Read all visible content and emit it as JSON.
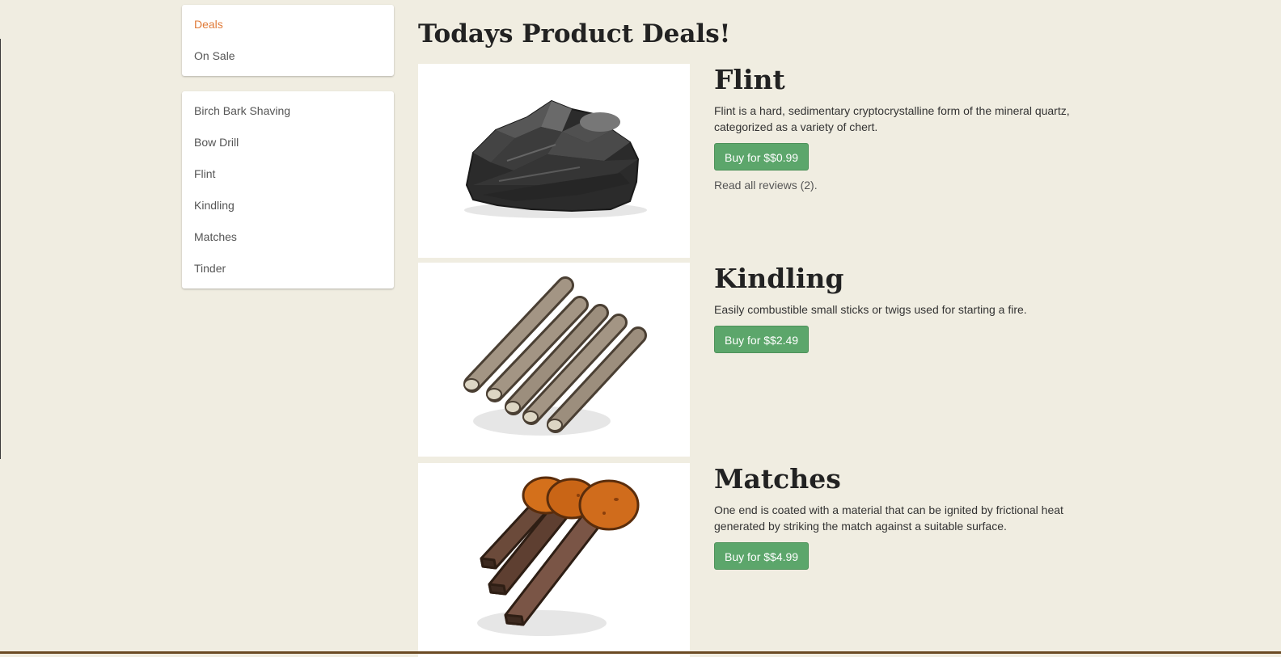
{
  "nav_top": {
    "items": [
      {
        "label": "Deals"
      },
      {
        "label": "On Sale"
      }
    ]
  },
  "nav_categories": {
    "items": [
      {
        "label": "Birch Bark Shaving"
      },
      {
        "label": "Bow Drill"
      },
      {
        "label": "Flint"
      },
      {
        "label": "Kindling"
      },
      {
        "label": "Matches"
      },
      {
        "label": "Tinder"
      }
    ]
  },
  "page_title": "Todays Product Deals!",
  "products": [
    {
      "name": "Flint",
      "description": "Flint is a hard, sedimentary cryptocrystalline form of the mineral quartz, categorized as a variety of chert.",
      "buy_label": "Buy for $$0.99",
      "reviews_label": "Read all reviews (2).",
      "image_icon": "flint-rock-icon"
    },
    {
      "name": "Kindling",
      "description": "Easily combustible small sticks or twigs used for starting a fire.",
      "buy_label": "Buy for $$2.49",
      "image_icon": "kindling-sticks-icon"
    },
    {
      "name": "Matches",
      "description": "One end is coated with a material that can be ignited by frictional heat generated by striking the match against a suitable surface.",
      "buy_label": "Buy for $$4.99",
      "image_icon": "matches-icon"
    }
  ],
  "colors": {
    "background": "#f0ede1",
    "active_nav": "#e07b39",
    "buy_button": "#5ca66b"
  }
}
